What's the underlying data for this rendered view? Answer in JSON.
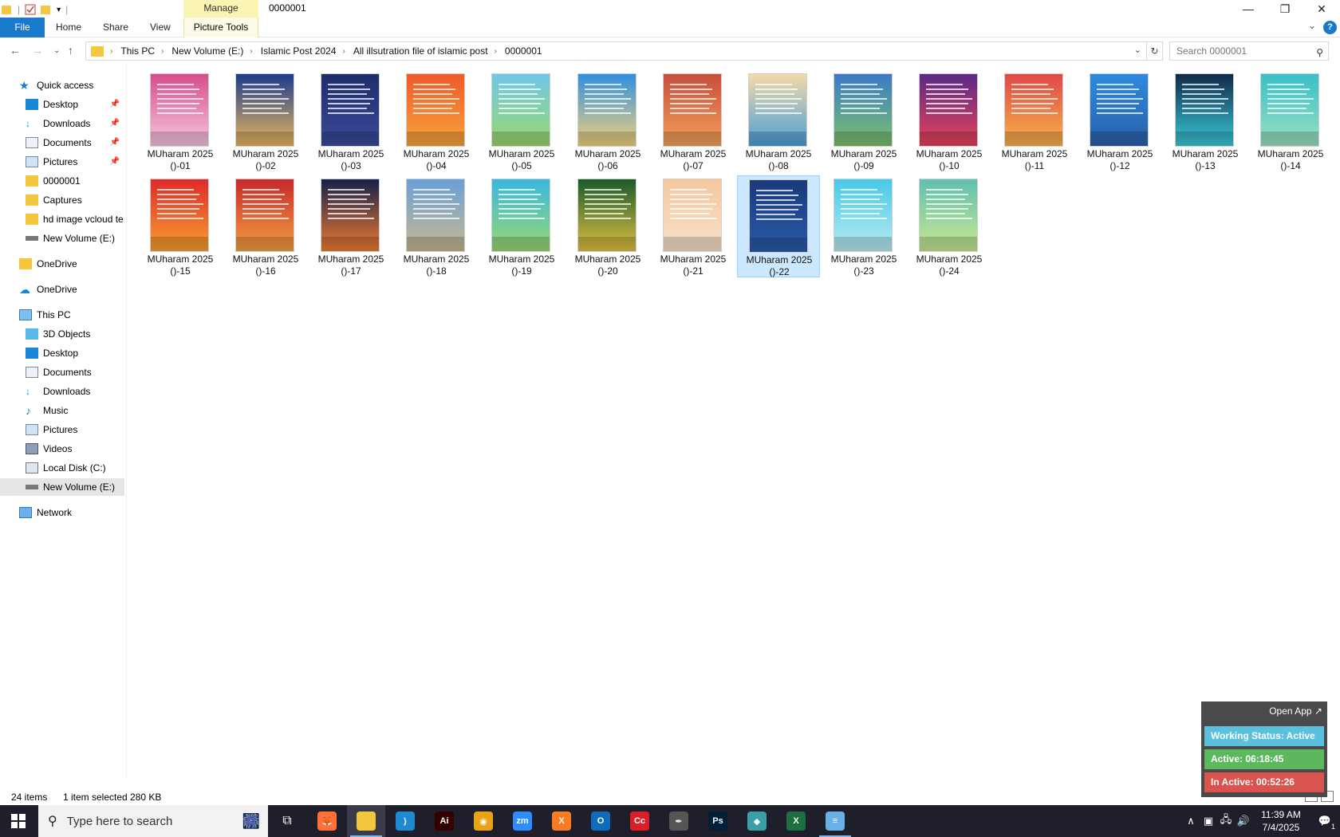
{
  "window": {
    "title": "0000001",
    "manage_tab": "Manage",
    "controls": {
      "minimize": "—",
      "restore": "❐",
      "close": "✕"
    }
  },
  "ribbon": {
    "file": "File",
    "home": "Home",
    "share": "Share",
    "view": "View",
    "picture_tools": "Picture Tools",
    "help": "?"
  },
  "address": {
    "crumbs": [
      "This PC",
      "New Volume (E:)",
      "Islamic Post 2024",
      "All illsutration file of islamic post",
      "0000001"
    ],
    "search_placeholder": "Search 0000001"
  },
  "sidebar": {
    "quick_access": "Quick access",
    "quick_items": [
      "Desktop",
      "Downloads",
      "Documents",
      "Pictures",
      "0000001",
      "Captures",
      "hd image vcloud te",
      "New Volume (E:)"
    ],
    "onedrive_1": "OneDrive",
    "onedrive_2": "OneDrive",
    "this_pc": "This PC",
    "pc_items": [
      "3D Objects",
      "Desktop",
      "Documents",
      "Downloads",
      "Music",
      "Pictures",
      "Videos",
      "Local Disk (C:)",
      "New Volume (E:)"
    ],
    "network": "Network"
  },
  "files": [
    {
      "line1": "MUharam 2025",
      "line2": "()-01"
    },
    {
      "line1": "MUharam 2025",
      "line2": "()-02"
    },
    {
      "line1": "MUharam 2025",
      "line2": "()-03"
    },
    {
      "line1": "MUharam 2025",
      "line2": "()-04"
    },
    {
      "line1": "MUharam 2025",
      "line2": "()-05"
    },
    {
      "line1": "MUharam 2025",
      "line2": "()-06"
    },
    {
      "line1": "MUharam 2025",
      "line2": "()-07"
    },
    {
      "line1": "MUharam 2025",
      "line2": "()-08"
    },
    {
      "line1": "MUharam 2025",
      "line2": "()-09"
    },
    {
      "line1": "MUharam 2025",
      "line2": "()-10"
    },
    {
      "line1": "MUharam 2025",
      "line2": "()-11"
    },
    {
      "line1": "MUharam 2025",
      "line2": "()-12"
    },
    {
      "line1": "MUharam 2025",
      "line2": "()-13"
    },
    {
      "line1": "MUharam 2025",
      "line2": "()-14"
    },
    {
      "line1": "MUharam 2025",
      "line2": "()-15"
    },
    {
      "line1": "MUharam 2025",
      "line2": "()-16"
    },
    {
      "line1": "MUharam 2025",
      "line2": "()-17"
    },
    {
      "line1": "MUharam 2025",
      "line2": "()-18"
    },
    {
      "line1": "MUharam 2025",
      "line2": "()-19"
    },
    {
      "line1": "MUharam 2025",
      "line2": "()-20"
    },
    {
      "line1": "MUharam 2025",
      "line2": "()-21"
    },
    {
      "line1": "MUharam 2025",
      "line2": "()-22"
    },
    {
      "line1": "MUharam 2025",
      "line2": "()-23"
    },
    {
      "line1": "MUharam 2025",
      "line2": "()-24"
    }
  ],
  "thumb_colors": [
    [
      "#d94c8a",
      "#f5c7df"
    ],
    [
      "#1c3c8c",
      "#e9b65c"
    ],
    [
      "#1d2d6b",
      "#3a4a9a"
    ],
    [
      "#f05a28",
      "#f7a43a"
    ],
    [
      "#6fc8e8",
      "#9bd86a"
    ],
    [
      "#2f8fe0",
      "#f3d27a"
    ],
    [
      "#c84d3c",
      "#f2a15a"
    ],
    [
      "#f5d9a8",
      "#4aa0d8"
    ],
    [
      "#3a7ac8",
      "#7cc06a"
    ],
    [
      "#5b2a86",
      "#e8425a"
    ],
    [
      "#e04848",
      "#f7b24a"
    ],
    [
      "#2b8be0",
      "#2b5fa8"
    ],
    [
      "#0f2a4a",
      "#3ac8d8"
    ],
    [
      "#38c0c8",
      "#9ae0c0"
    ],
    [
      "#e02a2a",
      "#f7a030"
    ],
    [
      "#c8282a",
      "#f2a040"
    ],
    [
      "#16204a",
      "#f07a30"
    ],
    [
      "#6aa0d8",
      "#c8b890"
    ],
    [
      "#38b8e0",
      "#9ad870"
    ],
    [
      "#1a5a2a",
      "#e0c040"
    ],
    [
      "#f6c8a0",
      "#f6e0c8"
    ],
    [
      "#1a3a7a",
      "#2a5aa8"
    ],
    [
      "#48c8e8",
      "#b8ecf0"
    ],
    [
      "#60c0b0",
      "#c8e890"
    ]
  ],
  "status": {
    "count": "24 items",
    "selection": "1 item selected  280 KB"
  },
  "tracker": {
    "open_app": "Open App ↗",
    "working": "Working Status: Active",
    "active": "Active: 06:18:45",
    "inactive": "In Active: 00:52:26",
    "working_color": "#5bc0de",
    "active_color": "#5cb85c",
    "inactive_color": "#d9534f"
  },
  "taskbar": {
    "search_placeholder": "Type here to search",
    "apps": [
      {
        "name": "firefox",
        "label": "🦊",
        "color": "#ff7139"
      },
      {
        "name": "file-explorer",
        "label": "",
        "color": "#f3c83f"
      },
      {
        "name": "vscode",
        "label": "⟩",
        "color": "#1f8ad2"
      },
      {
        "name": "illustrator",
        "label": "Ai",
        "color": "#330000"
      },
      {
        "name": "chrome",
        "label": "◉",
        "color": "#e8a317"
      },
      {
        "name": "zoom",
        "label": "zm",
        "color": "#2d8cff"
      },
      {
        "name": "xampp",
        "label": "X",
        "color": "#fb7a24"
      },
      {
        "name": "outlook",
        "label": "O",
        "color": "#0f6cbd"
      },
      {
        "name": "creative-cloud",
        "label": "Cc",
        "color": "#da1f26"
      },
      {
        "name": "pen-tool",
        "label": "✒",
        "color": "#555555"
      },
      {
        "name": "photoshop",
        "label": "Ps",
        "color": "#001e36"
      },
      {
        "name": "app-diamond",
        "label": "◆",
        "color": "#3aa0a8"
      },
      {
        "name": "excel",
        "label": "X",
        "color": "#1d6f42"
      },
      {
        "name": "notepad",
        "label": "≡",
        "color": "#6ab0e8"
      }
    ],
    "time": "11:39 AM",
    "date": "7/4/2025",
    "notification_count": "1"
  }
}
